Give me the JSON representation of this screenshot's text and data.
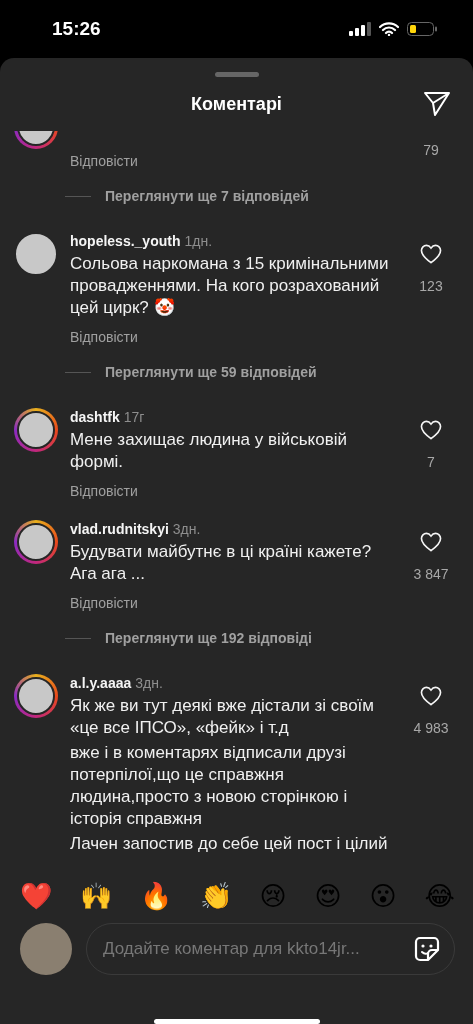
{
  "status_bar": {
    "time": "15:26"
  },
  "header": {
    "title": "Коментарі"
  },
  "comments": [
    {
      "kind": "comment",
      "cut_off": true,
      "story": true,
      "reply": "Відповісти",
      "likes": "79"
    },
    {
      "kind": "more",
      "label": "Переглянути ще 7 відповідей"
    },
    {
      "kind": "comment",
      "cut_off": false,
      "story": false,
      "username": "hopeless._youth",
      "time": "1дн.",
      "paragraphs": [
        "Сольова наркомана з 15 кримінальними провадженнями. На кого розрахований цей цирк? 🤡"
      ],
      "reply": "Відповісти",
      "likes": "123"
    },
    {
      "kind": "more",
      "label": "Переглянути ще 59 відповідей"
    },
    {
      "kind": "comment",
      "cut_off": false,
      "story": true,
      "username": "dashtfk",
      "time": "17г",
      "paragraphs": [
        "Мене захищає людина у військовій формі."
      ],
      "reply": "Відповісти",
      "likes": "7"
    },
    {
      "kind": "comment",
      "cut_off": false,
      "story": true,
      "username": "vlad.rudnitskyi",
      "time": "3дн.",
      "paragraphs": [
        "Будувати майбутнє в ці країні кажете? Ага ага ..."
      ],
      "reply": "Відповісти",
      "likes": "3 847"
    },
    {
      "kind": "more",
      "label": "Переглянути ще 192 відповіді"
    },
    {
      "kind": "comment",
      "cut_off": false,
      "story": true,
      "username": "a.l.y.aaaa",
      "time": "3дн.",
      "paragraphs": [
        "Як же ви тут деякі вже дістали зі своїм «це все ІПСО», «фейк» і т.д",
        "вже і в коментарях відписали друзі потерпілої,що це справжня людина,просто з новою сторінкою і історія справжня",
        "Лачен запостив до себе цей пост і цілий"
      ],
      "likes": "4 983"
    }
  ],
  "reactions": [
    "❤️",
    "🙌",
    "🔥",
    "👏",
    "😢",
    "😍",
    "😮",
    "😂"
  ],
  "composer": {
    "placeholder": "Додайте коментар для kkto14jr..."
  }
}
